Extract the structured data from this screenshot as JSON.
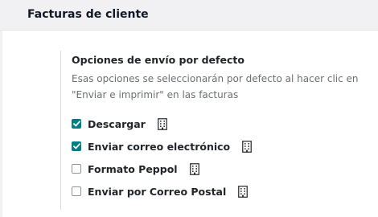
{
  "section": {
    "title": "Facturas de cliente"
  },
  "setting": {
    "title": "Opciones de envío por defecto",
    "description": "Esas opciones se seleccionarán por defecto al hacer clic en \"Enviar e imprimir\" en las facturas",
    "options": [
      {
        "label": "Descargar",
        "checked": true,
        "icon": "building-icon"
      },
      {
        "label": "Enviar correo electrónico",
        "checked": true,
        "icon": "building-icon"
      },
      {
        "label": "Formato Peppol",
        "checked": false,
        "icon": "building-icon"
      },
      {
        "label": "Enviar por Correo Postal",
        "checked": false,
        "icon": "building-icon"
      }
    ]
  },
  "colors": {
    "accent": "#017e84",
    "header_bg": "#f1f1f3",
    "muted_text": "#6b6f75"
  }
}
